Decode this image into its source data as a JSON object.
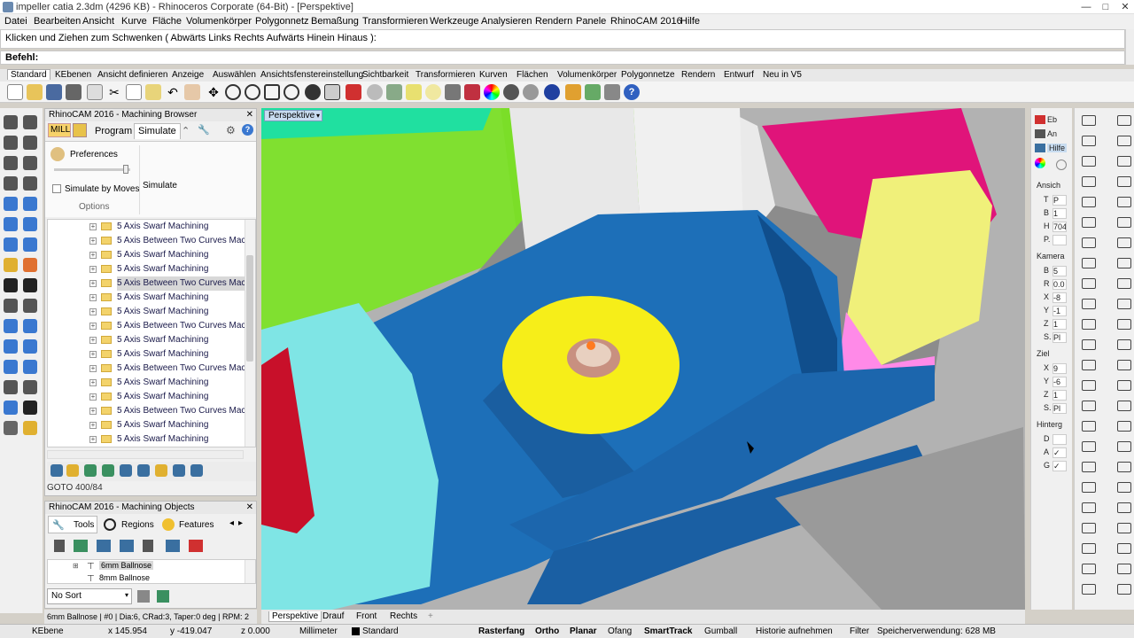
{
  "window": {
    "title": "impeller catia 2.3dm (4296 KB) - Rhinoceros Corporate (64-Bit) - [Perspektive]",
    "controls": [
      "—",
      "□",
      "✕"
    ]
  },
  "menu": [
    "Datei",
    "Bearbeiten",
    "Ansicht",
    "Kurve",
    "Fläche",
    "Volumenkörper",
    "Polygonnetz",
    "Bemaßung",
    "Transformieren",
    "Werkzeuge",
    "Analysieren",
    "Rendern",
    "Panele",
    "RhinoCAM 2016",
    "Hilfe"
  ],
  "command": {
    "history": "Klicken und Ziehen zum Schwenken ( Abwärts  Links  Rechts  Aufwärts  Hinein  Hinaus ):",
    "prompt": "Befehl:"
  },
  "toolbar_tabs": [
    "Standard",
    "KEbenen",
    "Ansicht definieren",
    "Anzeige",
    "Auswählen",
    "Ansichtsfenstereinstellung",
    "Sichtbarkeit",
    "Transformieren",
    "Kurven",
    "Flächen",
    "Volumenkörper",
    "Polygonnetze",
    "Rendern",
    "Entwurf",
    "Neu in V5"
  ],
  "browser": {
    "title": "RhinoCAM 2016 - Machining Browser",
    "close": "✕",
    "mode": "MILL",
    "tabs": [
      "Program",
      "Simulate"
    ],
    "preferences": "Preferences",
    "simulate_by_moves": "Simulate by Moves",
    "simulate_button": "Simulate",
    "options": "Options",
    "tree": [
      {
        "label": "5 Axis Swarf Machining",
        "selected": false
      },
      {
        "label": "5 Axis Between Two Curves Machi",
        "selected": false
      },
      {
        "label": "5 Axis Swarf Machining",
        "selected": false
      },
      {
        "label": "5 Axis Swarf Machining",
        "selected": false
      },
      {
        "label": "5 Axis Between Two Curves Machi",
        "selected": true
      },
      {
        "label": "5 Axis Swarf Machining",
        "selected": false
      },
      {
        "label": "5 Axis Swarf Machining",
        "selected": false
      },
      {
        "label": "5 Axis Between Two Curves Machi",
        "selected": false
      },
      {
        "label": "5 Axis Swarf Machining",
        "selected": false
      },
      {
        "label": "5 Axis Swarf Machining",
        "selected": false
      },
      {
        "label": "5 Axis Between Two Curves Machi",
        "selected": false
      },
      {
        "label": "5 Axis Swarf Machining",
        "selected": false
      },
      {
        "label": "5 Axis Swarf Machining",
        "selected": false
      },
      {
        "label": "5 Axis Between Two Curves Machi",
        "selected": false
      },
      {
        "label": "5 Axis Swarf Machining",
        "selected": false
      },
      {
        "label": "5 Axis Swarf Machining",
        "selected": false
      }
    ],
    "goto": "GOTO 400/84"
  },
  "objects": {
    "title": "RhinoCAM 2016 - Machining Objects",
    "close": "✕",
    "tabs": [
      "Tools",
      "Regions",
      "Features"
    ],
    "tools": [
      "6mm Ballnose",
      "8mm Ballnose"
    ],
    "sort": "No Sort"
  },
  "viewport": {
    "label": "Perspektive",
    "tabs": [
      "Perspektive",
      "Drauf",
      "Front",
      "Rechts"
    ],
    "add": "+"
  },
  "props": {
    "tabs": [
      "Eb",
      "An",
      "Hilfe"
    ],
    "ansicht": "Ansich",
    "ansicht_rows": [
      [
        "T",
        "P"
      ],
      [
        "B",
        "1"
      ],
      [
        "H",
        "704"
      ],
      [
        "P.",
        ""
      ]
    ],
    "kamera": "Kamera",
    "kamera_rows": [
      [
        "B",
        "5"
      ],
      [
        "R",
        "0.0"
      ],
      [
        "X",
        "-8"
      ],
      [
        "Y",
        "-1"
      ],
      [
        "Z",
        "1"
      ],
      [
        "S.",
        "Pl"
      ]
    ],
    "ziel": "Ziel",
    "ziel_rows": [
      [
        "X",
        "9"
      ],
      [
        "Y",
        "-6"
      ],
      [
        "Z",
        "1"
      ],
      [
        "S.",
        "Pl"
      ]
    ],
    "hinter": "Hinterg",
    "hinter_rows": [
      [
        "D",
        ""
      ],
      [
        "A",
        "✓"
      ],
      [
        "G",
        "✓"
      ]
    ]
  },
  "tool_status": "6mm Ballnose | #0 | Dia:6, CRad:3, Taper:0 deg | RPM: 2",
  "status": {
    "layer": "KEbene",
    "x": "x 145.954",
    "y": "y -419.047",
    "z": "z 0.000",
    "units": "Millimeter",
    "current_layer": "Standard",
    "toggles": [
      "Rasterfang",
      "Ortho",
      "Planar",
      "Ofang",
      "SmartTrack",
      "Gumball",
      "Historie aufnehmen",
      "Filter"
    ],
    "memory": "Speicherverwendung: 628 MB"
  },
  "colors": {
    "part_blue": "#1f6fb5",
    "part_yellow": "#f5ec1a",
    "magenta": "#e01a7a",
    "green": "#7ee02a",
    "cyan": "#7de8e8"
  }
}
